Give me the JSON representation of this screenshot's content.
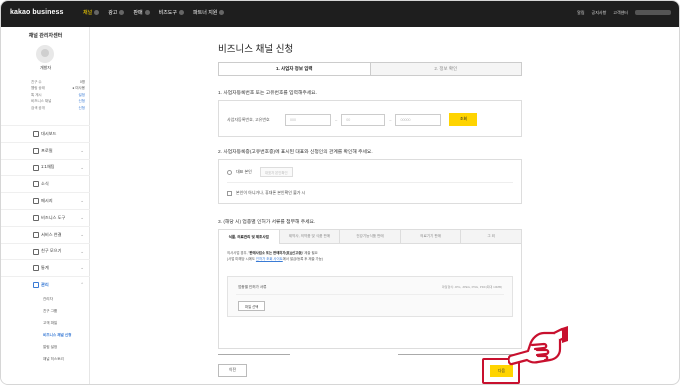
{
  "topbar": {
    "logo": "kakao business",
    "nav": [
      {
        "label": "채널",
        "active": true
      },
      {
        "label": "광고",
        "active": false
      },
      {
        "label": "판매",
        "active": false
      },
      {
        "label": "비즈도구",
        "active": false
      },
      {
        "label": "파트너 지원",
        "active": false
      }
    ],
    "right": [
      "알림",
      "공지사항",
      "고객센터"
    ]
  },
  "sidebar": {
    "title": "채널 관리자센터",
    "channel_name": "개발자",
    "stats": [
      {
        "label": "친구 수",
        "value": "0명",
        "link": false
      },
      {
        "label": "웹링 상태",
        "value": "● 미사용",
        "link": false
      },
      {
        "label": "톡 게시",
        "value": "설정",
        "link": true
      },
      {
        "label": "비즈니스 채널",
        "value": "신청",
        "link": true
      },
      {
        "label": "검색 공개",
        "value": "신청",
        "link": true
      }
    ],
    "menu": [
      {
        "label": "대시보드",
        "icon": "dashboard-icon",
        "chev": false
      },
      {
        "label": "프로필",
        "icon": "profile-icon",
        "chev": true
      },
      {
        "label": "1:1채팅",
        "icon": "chat-icon",
        "chev": true
      },
      {
        "label": "소식",
        "icon": "post-icon",
        "chev": false
      },
      {
        "label": "메시지",
        "icon": "message-icon",
        "chev": true
      },
      {
        "label": "비즈니스 도구",
        "icon": "tool-icon",
        "chev": true
      },
      {
        "label": "서비스 연결",
        "icon": "link-icon",
        "chev": true
      },
      {
        "label": "친구 모으기",
        "icon": "friends-icon",
        "chev": true
      },
      {
        "label": "통계",
        "icon": "stats-icon",
        "chev": true
      },
      {
        "label": "관리",
        "icon": "settings-icon",
        "chev": true,
        "open": true
      }
    ],
    "submenu": [
      {
        "label": "관리자",
        "active": false
      },
      {
        "label": "친구 그룹",
        "active": false
      },
      {
        "label": "고객 파일",
        "active": false
      },
      {
        "label": "비즈니스 채널 신청",
        "active": true
      },
      {
        "label": "알림 설정",
        "active": false
      },
      {
        "label": "채널 히스토리",
        "active": false
      }
    ]
  },
  "main": {
    "title": "비즈니스 채널 신청",
    "steps": [
      "1. 사업자 정보 입력",
      "2. 정보 확인"
    ],
    "section1": {
      "title": "1. 사업자등록번호 또는 고유번호를 입력해주세요.",
      "label": "사업자등록번호, 고유번호",
      "inputs": [
        "000",
        "00",
        "00000"
      ],
      "button": "조회"
    },
    "section2": {
      "title": "2. 사업자등록증(고유번호증)에 표시된 대표와 신청인의 관계를 확인해 주세요.",
      "option1": "대표 본인",
      "option1_input": "대표자 본인확인",
      "option2": "본인이 아니거나, 휴대폰 본인확인 불가 시"
    },
    "section3": {
      "title": "3. (해당 시) 업종별 인허가 서류를 첨부해 주세요.",
      "tabs": [
        "식품, 의료관리 및 제조사업",
        "제약사, 의약품 및 식품 판매",
        "건강기능식품 판매",
        "의료기기 판매",
        "그 외"
      ],
      "desc_line1_pre": "의사사업 경우, ",
      "desc_line1_bold": "'판매사업소 또는 판매허가(표)(신고증)'",
      "desc_line1_post": " 제출 필요",
      "desc_line2_pre": "(사업 미해당 시에도 ",
      "desc_line2_link": "인허가 조회 사이트",
      "desc_line2_post": "에서 발급/등록 후 제출 가능)",
      "upload_label": "업종별 인허가 서류",
      "upload_hint": "파일형식: JPG, JPEG, PNG, PDF(최대 10MB)",
      "upload_button": "파일 선택"
    },
    "prev_button": "이전",
    "next_button": "다음"
  }
}
